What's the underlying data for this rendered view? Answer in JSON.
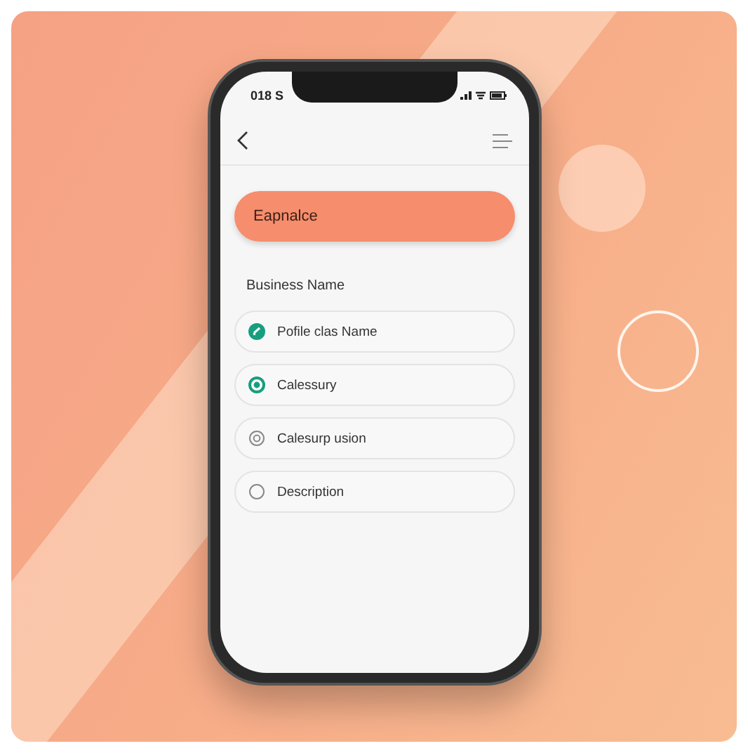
{
  "status_bar": {
    "time": "018 S"
  },
  "primary_button": {
    "label": "Eapnalce"
  },
  "section_label": "Business Name",
  "steps": [
    {
      "label": "Pofile clas Name",
      "kind": "done"
    },
    {
      "label": "Calessury",
      "kind": "current"
    },
    {
      "label": "Calesurp usion",
      "kind": "partial"
    },
    {
      "label": "Description",
      "kind": "empty"
    }
  ]
}
